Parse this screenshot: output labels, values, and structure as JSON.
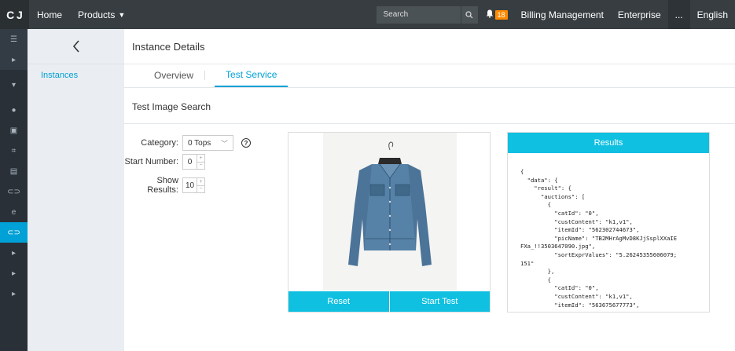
{
  "topbar": {
    "logo": "C J",
    "home": "Home",
    "products": "Products",
    "search_placeholder": "Search",
    "notification_count": "18",
    "billing": "Billing Management",
    "enterprise": "Enterprise",
    "more": "...",
    "language": "English"
  },
  "sidebar": {
    "icons": [
      "menu-icon",
      "expand-arrow-icon",
      "collapse-arrow-icon",
      "dot-icon",
      "ecs-icon",
      "chart-icon",
      "database-icon",
      "cloud-icon",
      "e-icon",
      "image-search-icon",
      "expand-arrow-icon",
      "expand-arrow-icon",
      "expand-arrow-icon"
    ]
  },
  "subside": {
    "back": "<",
    "instances": "Instances"
  },
  "main": {
    "title": "Instance Details",
    "tabs": [
      "Overview",
      "Test Service"
    ],
    "active_tab": "Test Service",
    "section_title": "Test Image Search",
    "form": {
      "category_label": "Category:",
      "category_value": "0 Tops",
      "start_label": "Start Number:",
      "start_value": "0",
      "show_label": "Show Results:",
      "show_value": "10"
    },
    "buttons": {
      "reset": "Reset",
      "start_test": "Start Test"
    },
    "results_title": "Results",
    "results_text": "{\n  \"data\": {\n    \"result\": {\n      \"auctions\": [\n        {\n          \"catId\": \"0\",\n          \"custContent\": \"k1,v1\",\n          \"itemId\": \"562302744673\",\n          \"picName\": \"TB2MHrAgMvD8KJjSsplXXaIE\nFXa_!!3503647090.jpg\",\n          \"sortExprValues\": \"5.26245355606079;\n151\"\n        },\n        {\n          \"catId\": \"0\",\n          \"custContent\": \"k1,v1\",\n          \"itemId\": \"563675677773\","
  },
  "colors": {
    "accent": "#00a1d6",
    "button": "#0fc0e1",
    "topbar": "#373d41",
    "sidebar": "#293038",
    "badge": "#ff8a00"
  }
}
